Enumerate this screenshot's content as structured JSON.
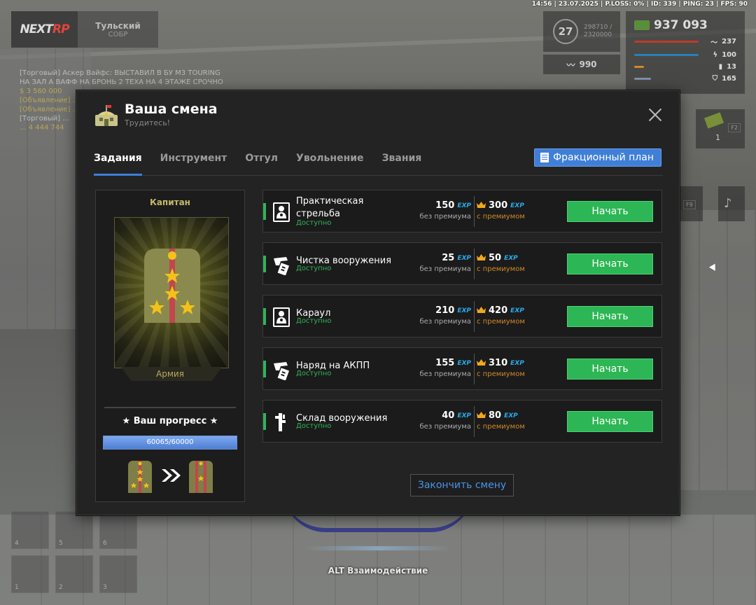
{
  "status_line": "14:56 | 23.07.2025 | P.LOSS: 0% | ID: 339 | PING: 23 | FPS: 90",
  "brand": {
    "logo_a": "NEXT",
    "logo_b": "RP",
    "faction": "Тульский",
    "faction_sub": "СОБР"
  },
  "hud": {
    "level": "27",
    "exp_cur": "298710 /",
    "exp_max": "2320000",
    "money": "937 093",
    "secondary_value": "990",
    "stats": [
      {
        "value": "237",
        "color": "#c0392b"
      },
      {
        "value": "100",
        "color": "#2980b9"
      },
      {
        "value": "13",
        "color": "#d08a2a"
      },
      {
        "value": "165",
        "color": "#7f8fa6"
      }
    ],
    "slot_value": "1",
    "key_f2": "F2",
    "key_f9": "F9"
  },
  "hotbar": [
    "4",
    "5",
    "6",
    "1",
    "2",
    "3"
  ],
  "alt_hint": "ALT Взаимодействие",
  "modal": {
    "title": "Ваша смена",
    "subtitle": "Трудитесь!",
    "tabs": [
      "Задания",
      "Инструмент",
      "Отгул",
      "Увольнение",
      "Звания"
    ],
    "active_tab": 0,
    "plan_button": "Фракционный план",
    "rank": {
      "name": "Капитан",
      "branch": "Армия",
      "progress_label": "★ Ваш прогресс ★",
      "progress_text": "60065/60000",
      "progress_fraction": 1.0
    },
    "exp_tag": "EXP",
    "caption_no_premium": "без премиума",
    "caption_premium": "с премиумом",
    "start_label": "Начать",
    "tasks": [
      {
        "name": "Практическая стрельба",
        "status": "Доступно",
        "exp": "150",
        "exp_premium": "300",
        "icon": "target-icon"
      },
      {
        "name": "Чистка вооружения",
        "status": "Доступно",
        "exp": "25",
        "exp_premium": "50",
        "icon": "pistol-cleaning-icon"
      },
      {
        "name": "Караул",
        "status": "Доступно",
        "exp": "210",
        "exp_premium": "420",
        "icon": "target-icon"
      },
      {
        "name": "Наряд на АКПП",
        "status": "Доступно",
        "exp": "155",
        "exp_premium": "310",
        "icon": "pistol-cleaning-icon"
      },
      {
        "name": "Склад вооружения",
        "status": "Доступно",
        "exp": "40",
        "exp_premium": "80",
        "icon": "weapon-storage-icon"
      }
    ],
    "end_shift": "Закончить смену"
  }
}
